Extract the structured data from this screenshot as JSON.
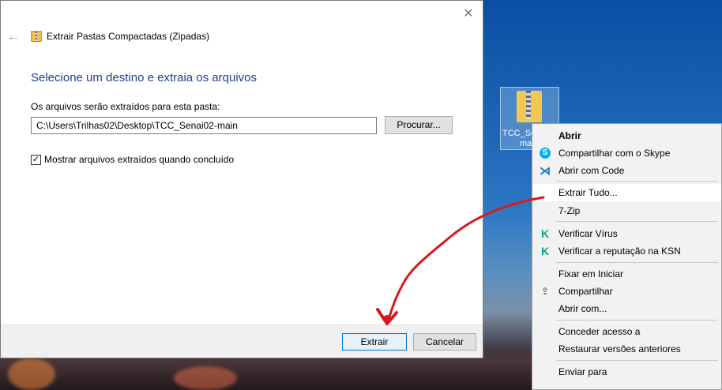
{
  "dialog": {
    "title": "Extrair Pastas Compactadas (Zipadas)",
    "heading": "Selecione um destino e extraia os arquivos",
    "field_label": "Os arquivos serão extraídos para esta pasta:",
    "path_value": "C:\\Users\\Trilhas02\\Desktop\\TCC_Senai02-main",
    "browse_label": "Procurar...",
    "checkbox_label": "Mostrar arquivos extraídos quando concluído",
    "checkbox_checked": true,
    "extract_label": "Extrair",
    "cancel_label": "Cancelar",
    "close_glyph": "✕",
    "back_glyph": "←"
  },
  "desktop_icon": {
    "label_line1": "TCC_Se",
    "label_line2": "ma"
  },
  "context_menu": {
    "items": [
      {
        "label": "Abrir",
        "icon": "none"
      },
      {
        "label": "Compartilhar com o Skype",
        "icon": "skype-icon"
      },
      {
        "label": "Abrir com Code",
        "icon": "vscode-icon"
      },
      {
        "label": "Extrair Tudo...",
        "icon": "none"
      },
      {
        "label": "7-Zip",
        "icon": "none"
      },
      {
        "label": "Verificar Vírus",
        "icon": "kaspersky-icon"
      },
      {
        "label": "Verificar a reputação na KSN",
        "icon": "kaspersky-icon"
      },
      {
        "label": "Fixar em Iniciar",
        "icon": "none"
      },
      {
        "label": "Compartilhar",
        "icon": "share-icon"
      },
      {
        "label": "Abrir com...",
        "icon": "none"
      },
      {
        "label": "Conceder acesso a",
        "icon": "none"
      },
      {
        "label": "Restaurar versões anteriores",
        "icon": "none"
      },
      {
        "label": "Enviar para",
        "icon": "none"
      }
    ]
  },
  "colors": {
    "heading": "#1e3f8a",
    "accent_border": "#0078d7",
    "annotation_arrow": "#d7191c"
  }
}
